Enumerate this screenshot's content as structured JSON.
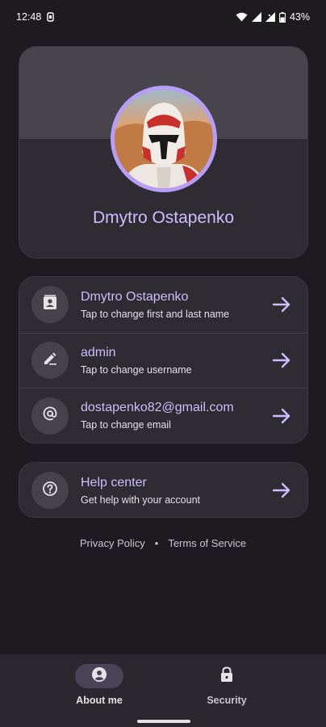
{
  "status_bar": {
    "time": "12:48",
    "battery": "43%"
  },
  "profile": {
    "name": "Dmytro Ostapenko"
  },
  "account_rows": [
    {
      "title": "Dmytro Ostapenko",
      "subtitle": "Tap to change first and last name",
      "icon": "contact-card-icon"
    },
    {
      "title": "admin",
      "subtitle": "Tap to change username",
      "icon": "pencil-icon"
    },
    {
      "title": "dostapenko82@gmail.com",
      "subtitle": "Tap to change email",
      "icon": "at-sign-icon"
    }
  ],
  "help": {
    "title": "Help center",
    "subtitle": "Get help with your account",
    "icon": "help-circle-icon"
  },
  "footer": {
    "privacy": "Privacy Policy",
    "separator": "•",
    "terms": "Terms of Service"
  },
  "bottom_nav": {
    "items": [
      {
        "label": "About me",
        "icon": "account-circle-icon",
        "selected": true
      },
      {
        "label": "Security",
        "icon": "lock-icon",
        "selected": false
      }
    ]
  },
  "colors": {
    "accent": "#d0bcff",
    "avatar_ring": "#b69df8",
    "background": "#1d1b20",
    "card": "#2e2b33"
  }
}
